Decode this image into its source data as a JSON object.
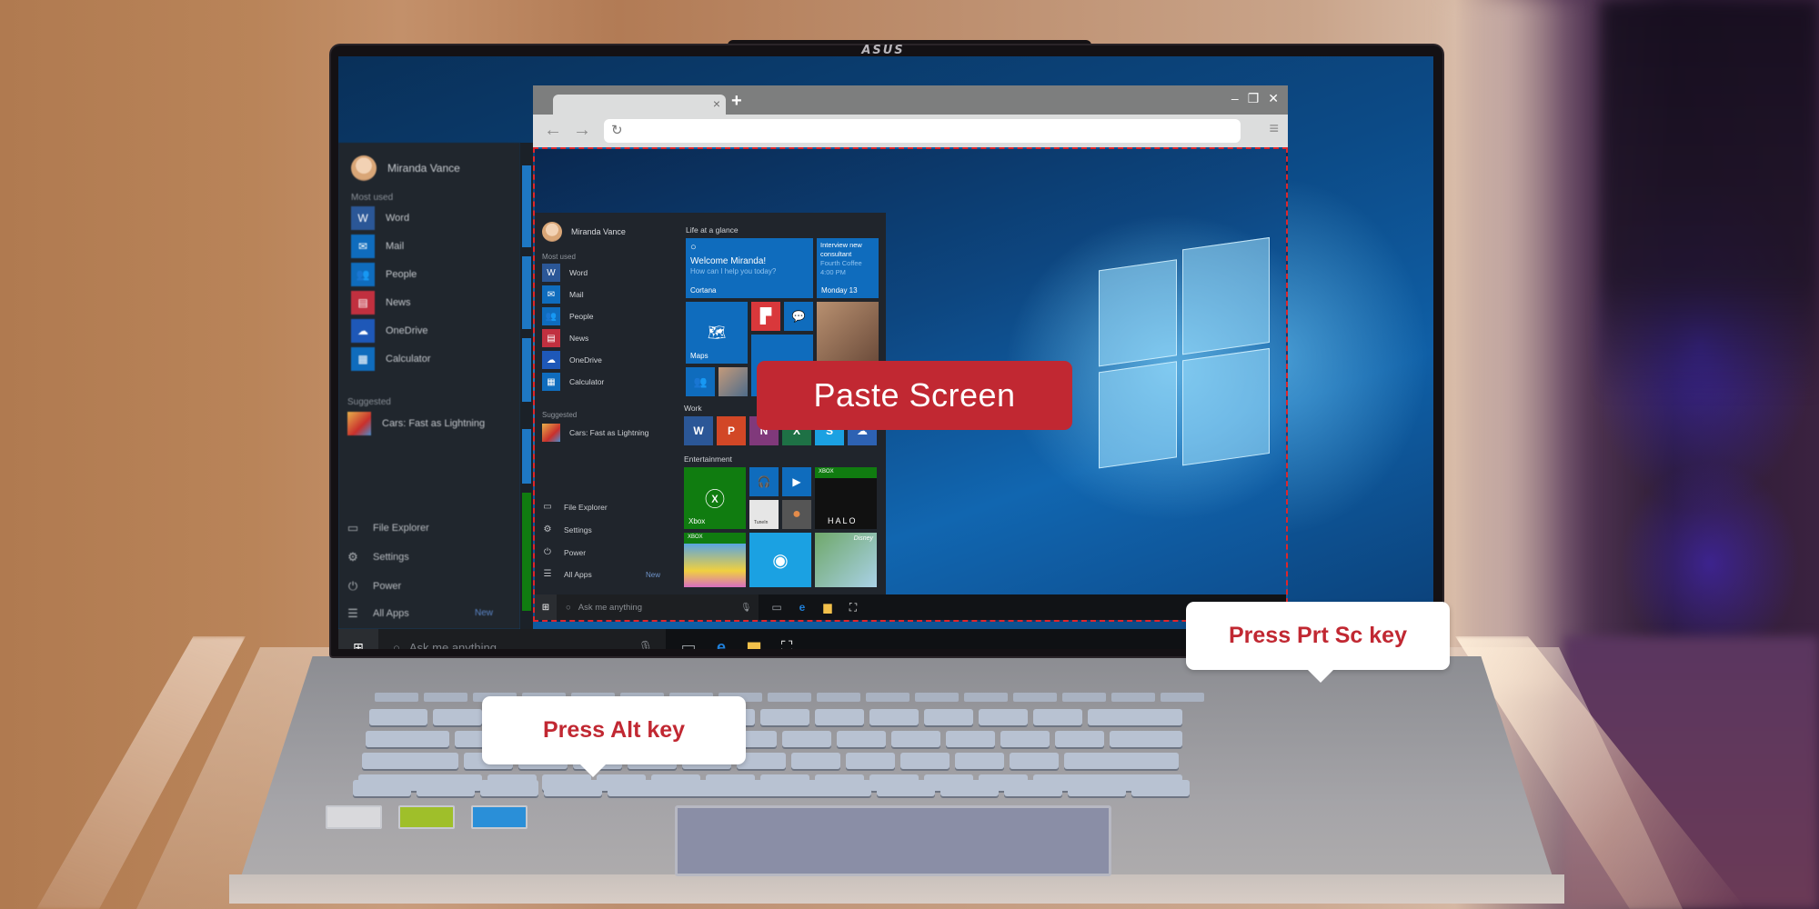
{
  "device": {
    "brand_logo": "ASUS"
  },
  "desktop": {
    "start_menu": {
      "user_name": "Miranda Vance",
      "most_used_label": "Most used",
      "most_used": [
        {
          "label": "Word",
          "icon": "word-icon",
          "color": "#2b5797"
        },
        {
          "label": "Mail",
          "icon": "mail-icon",
          "color": "#0f6cbd"
        },
        {
          "label": "People",
          "icon": "people-icon",
          "color": "#0f6cbd"
        },
        {
          "label": "News",
          "icon": "news-icon",
          "color": "#c1303f"
        },
        {
          "label": "OneDrive",
          "icon": "onedrive-icon",
          "color": "#1e58b8"
        },
        {
          "label": "Calculator",
          "icon": "calculator-icon",
          "color": "#0f6cbd"
        }
      ],
      "suggested_label": "Suggested",
      "suggested": [
        {
          "label": "Cars: Fast as Lightning",
          "icon": "cars-game-icon"
        }
      ],
      "bottom": [
        {
          "label": "File Explorer",
          "icon": "folder-icon"
        },
        {
          "label": "Settings",
          "icon": "gear-icon"
        },
        {
          "label": "Power",
          "icon": "power-icon"
        },
        {
          "label": "All Apps",
          "icon": "list-icon",
          "badge": "New"
        }
      ]
    },
    "taskbar": {
      "search_placeholder": "Ask me anything",
      "icons": [
        "task-view-icon",
        "edge-icon",
        "file-explorer-icon",
        "store-icon"
      ]
    }
  },
  "browser": {
    "tab_close": "×",
    "new_tab": "+",
    "window_controls": {
      "minimize": "–",
      "restore": "❐",
      "close": "✕"
    },
    "back": "←",
    "forward": "→",
    "reload": "↻",
    "address_value": "",
    "menu": "≡",
    "pasted_start_menu": {
      "user_name": "Miranda Vance",
      "most_used_label": "Most used",
      "most_used": [
        {
          "label": "Word",
          "color": "#2b5797"
        },
        {
          "label": "Mail",
          "color": "#0f6cbd"
        },
        {
          "label": "People",
          "color": "#0f6cbd"
        },
        {
          "label": "News",
          "color": "#c1303f"
        },
        {
          "label": "OneDrive",
          "color": "#1e58b8"
        },
        {
          "label": "Calculator",
          "color": "#0f6cbd"
        }
      ],
      "suggested_label": "Suggested",
      "suggested": [
        {
          "label": "Cars: Fast as Lightning"
        }
      ],
      "bottom": [
        {
          "label": "File Explorer"
        },
        {
          "label": "Settings"
        },
        {
          "label": "Power"
        },
        {
          "label": "All Apps",
          "badge": "New"
        }
      ],
      "groups": {
        "life": "Life at a glance",
        "work": "Work",
        "entertainment": "Entertainment"
      },
      "cortana_tile": {
        "title": "Welcome Miranda!",
        "subtitle": "How can I help you today?",
        "label": "Cortana"
      },
      "calendar_tile": {
        "line1": "Interview new",
        "line2": "consultant",
        "line3": "Fourth Coffee",
        "line4": "4:00 PM",
        "date": "Monday 13"
      },
      "maps_label": "Maps",
      "xbox_label": "Xbox",
      "xbox_badge": "XBOX",
      "halo_label": "HALO",
      "tunein_label": "TuneIn",
      "disney_label": "Disney",
      "work_tiles": [
        {
          "letter": "W",
          "color": "#2b5797",
          "name": "word"
        },
        {
          "letter": "P",
          "color": "#d24726",
          "name": "powerpoint"
        },
        {
          "letter": "N",
          "color": "#80397b",
          "name": "onenote"
        },
        {
          "letter": "X",
          "color": "#1e7145",
          "name": "excel"
        },
        {
          "letter": "S",
          "color": "#1ba1e2",
          "name": "skype"
        },
        {
          "letter": "☁",
          "color": "#2d62b3",
          "name": "onedrive"
        }
      ],
      "taskbar_search": "Ask me anything"
    }
  },
  "overlay": {
    "paste_label": "Paste Screen",
    "callout_alt": "Press Alt key",
    "callout_prtsc": "Press Prt Sc key",
    "accent": "#c12832"
  }
}
